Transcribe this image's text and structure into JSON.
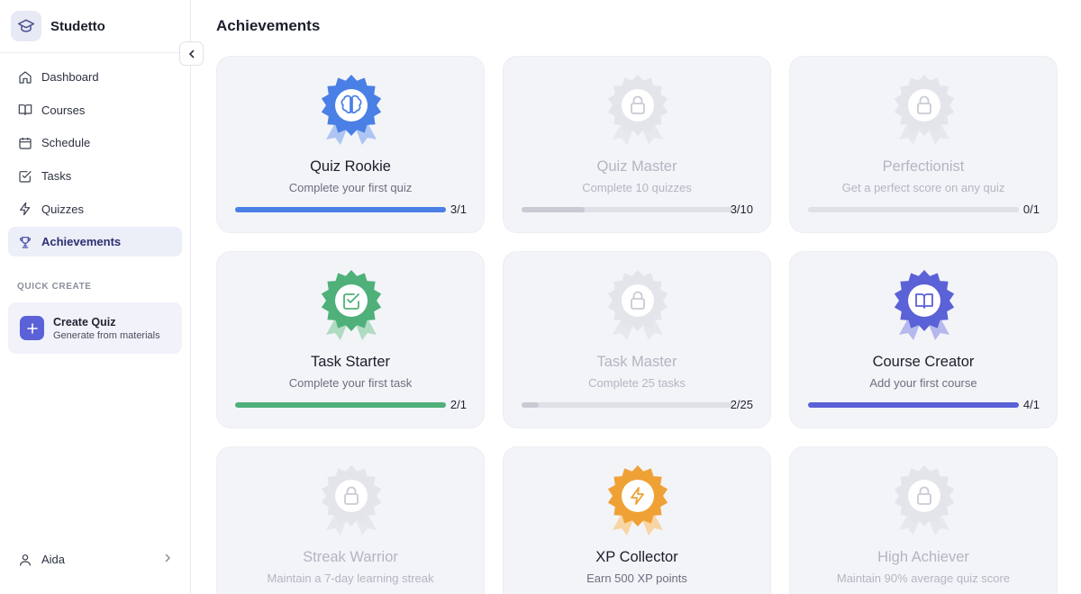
{
  "app": {
    "name": "Studetto"
  },
  "sidebar": {
    "items": [
      {
        "label": "Dashboard",
        "icon": "home-icon"
      },
      {
        "label": "Courses",
        "icon": "book-icon"
      },
      {
        "label": "Schedule",
        "icon": "calendar-icon"
      },
      {
        "label": "Tasks",
        "icon": "checkbox-icon"
      },
      {
        "label": "Quizzes",
        "icon": "lightning-icon"
      },
      {
        "label": "Achievements",
        "icon": "trophy-icon",
        "active": true
      }
    ],
    "quick_create_title": "QUICK CREATE",
    "quick_create": {
      "label": "Create Quiz",
      "sublabel": "Generate from materials"
    },
    "user": {
      "name": "Aida"
    }
  },
  "main": {
    "title": "Achievements",
    "achievements": [
      {
        "title": "Quiz Rookie",
        "desc": "Complete your first quiz",
        "progress_text": "3/1",
        "progress": 1.0,
        "unlocked": true,
        "color": "#4a7fe6",
        "icon": "brain-icon"
      },
      {
        "title": "Quiz Master",
        "desc": "Complete 10 quizzes",
        "progress_text": "3/10",
        "progress": 0.3,
        "unlocked": false,
        "color": "#c8cbd3",
        "icon": "lock-icon"
      },
      {
        "title": "Perfectionist",
        "desc": "Get a perfect score on any quiz",
        "progress_text": "0/1",
        "progress": 0.0,
        "unlocked": false,
        "color": "#c8cbd3",
        "icon": "lock-icon"
      },
      {
        "title": "Task Starter",
        "desc": "Complete your first task",
        "progress_text": "2/1",
        "progress": 1.0,
        "unlocked": true,
        "color": "#4fb07a",
        "icon": "checkbox-icon"
      },
      {
        "title": "Task Master",
        "desc": "Complete 25 tasks",
        "progress_text": "2/25",
        "progress": 0.08,
        "unlocked": false,
        "color": "#c8cbd3",
        "icon": "lock-icon"
      },
      {
        "title": "Course Creator",
        "desc": "Add your first course",
        "progress_text": "4/1",
        "progress": 1.0,
        "unlocked": true,
        "color": "#5b61d6",
        "icon": "book-icon"
      },
      {
        "title": "Streak Warrior",
        "desc": "Maintain a 7-day learning streak",
        "unlocked": false,
        "color": "#c8cbd3",
        "icon": "lock-icon"
      },
      {
        "title": "XP Collector",
        "desc": "Earn 500 XP points",
        "unlocked": true,
        "color": "#efa136",
        "icon": "lightning-icon"
      },
      {
        "title": "High Achiever",
        "desc": "Maintain 90% average quiz score",
        "unlocked": false,
        "color": "#c8cbd3",
        "icon": "lock-icon"
      }
    ]
  }
}
